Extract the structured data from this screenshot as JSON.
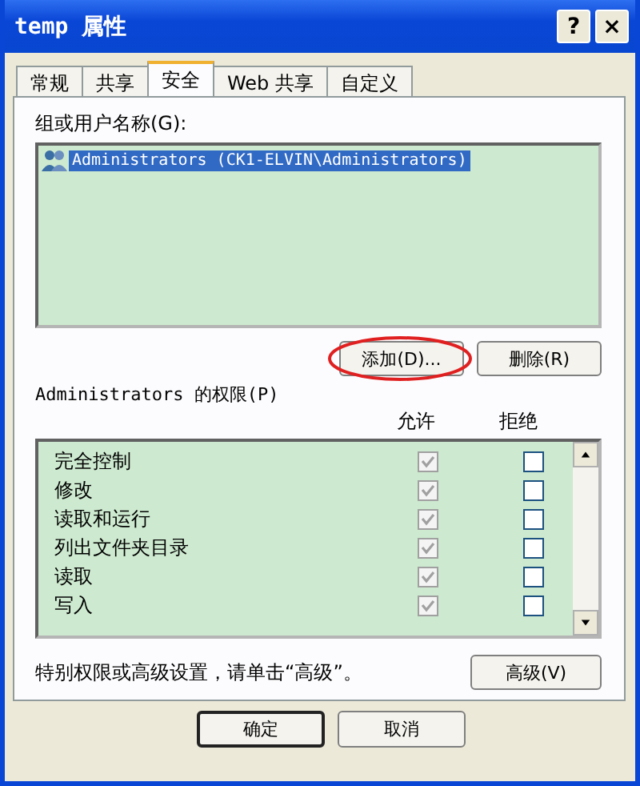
{
  "window": {
    "title": "temp 属性",
    "help_button": "?",
    "close_button": "×"
  },
  "tabs": [
    {
      "label": "常规",
      "selected": false
    },
    {
      "label": "共享",
      "selected": false
    },
    {
      "label": "安全",
      "selected": true
    },
    {
      "label": "Web 共享",
      "selected": false
    },
    {
      "label": "自定义",
      "selected": false
    }
  ],
  "group_label": "组或用户名称(G):",
  "users": [
    {
      "name": "Administrators (CK1-ELVIN\\Administrators)",
      "selected": true
    }
  ],
  "add_button": "添加(D)...",
  "add_highlighted": true,
  "remove_button": "删除(R)",
  "permissions_label": "Administrators 的权限(P)",
  "columns": [
    "允许",
    "拒绝"
  ],
  "permissions": [
    {
      "name": "完全控制",
      "allow": true,
      "allow_disabled": true,
      "deny": false
    },
    {
      "name": "修改",
      "allow": true,
      "allow_disabled": true,
      "deny": false
    },
    {
      "name": "读取和运行",
      "allow": true,
      "allow_disabled": true,
      "deny": false
    },
    {
      "name": "列出文件夹目录",
      "allow": true,
      "allow_disabled": true,
      "deny": false
    },
    {
      "name": "读取",
      "allow": true,
      "allow_disabled": true,
      "deny": false
    },
    {
      "name": "写入",
      "allow": true,
      "allow_disabled": true,
      "deny": false
    }
  ],
  "advanced_note": "特别权限或高级设置，请单击“高级”。",
  "advanced_button": "高级(V)",
  "footer_buttons": [
    "确定",
    "取消"
  ]
}
